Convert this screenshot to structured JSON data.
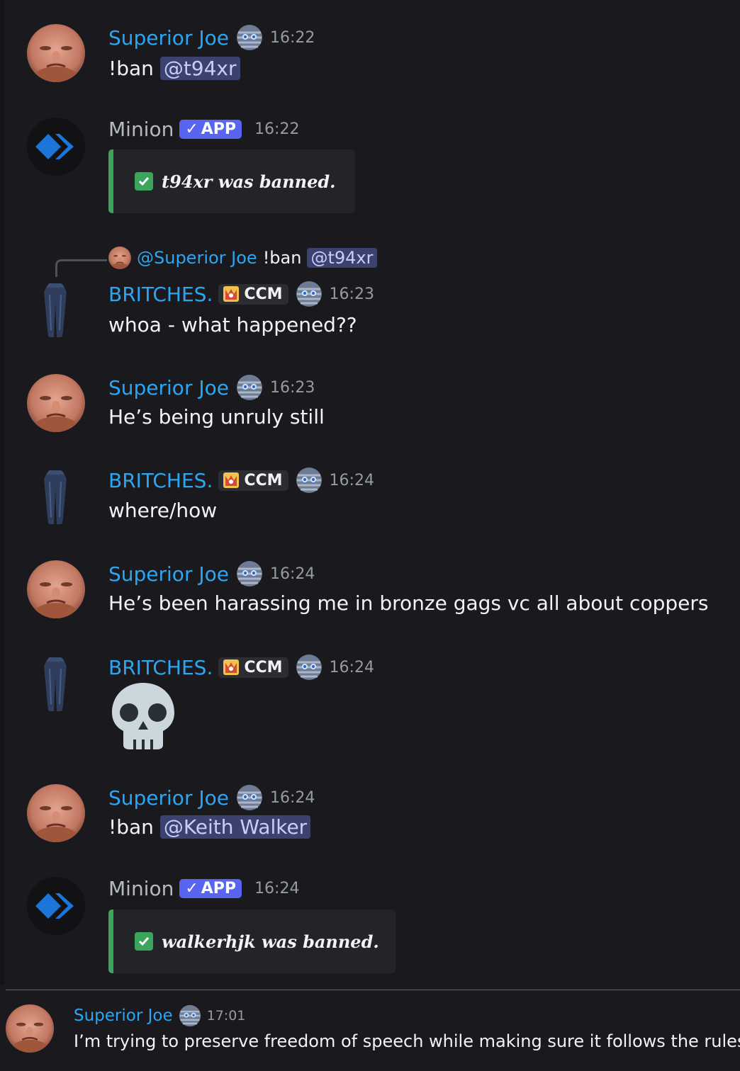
{
  "messages": [
    {
      "author": "Superior Joe",
      "time": "16:22",
      "text": "!ban ",
      "mention": "@t94xr"
    },
    {
      "author": "Minion",
      "badge": "APP",
      "time": "16:22",
      "embed": "t94xr was banned."
    },
    {
      "reply": {
        "author": "@Superior Joe",
        "text": "!ban",
        "mention": "@t94xr"
      },
      "author": "BRITCHES.",
      "tag": "CCM",
      "time": "16:23",
      "text": "whoa - what happened??"
    },
    {
      "author": "Superior Joe",
      "time": "16:23",
      "text": "He’s being unruly still"
    },
    {
      "author": "BRITCHES.",
      "tag": "CCM",
      "time": "16:24",
      "text": "where/how"
    },
    {
      "author": "Superior Joe",
      "time": "16:24",
      "text": "He’s been harassing me in bronze gags vc all about coppers"
    },
    {
      "author": "BRITCHES.",
      "tag": "CCM",
      "time": "16:24",
      "emoji": "skull"
    },
    {
      "author": "Superior Joe",
      "time": "16:24",
      "text": "!ban ",
      "mention": "@Keith Walker"
    },
    {
      "author": "Minion",
      "badge": "APP",
      "time": "16:24",
      "embed": "walkerhjk was banned."
    },
    {
      "author": "Superior Joe",
      "time": "17:01",
      "text": "I’m trying to preserve freedom of speech while making sure it follows the rules"
    }
  ],
  "colors": {
    "username": "#2aa6f2",
    "mention_bg": "#3c4270",
    "embed_border": "#3ba55c",
    "app_badge": "#5865f2",
    "divider": "#c73b3b"
  }
}
